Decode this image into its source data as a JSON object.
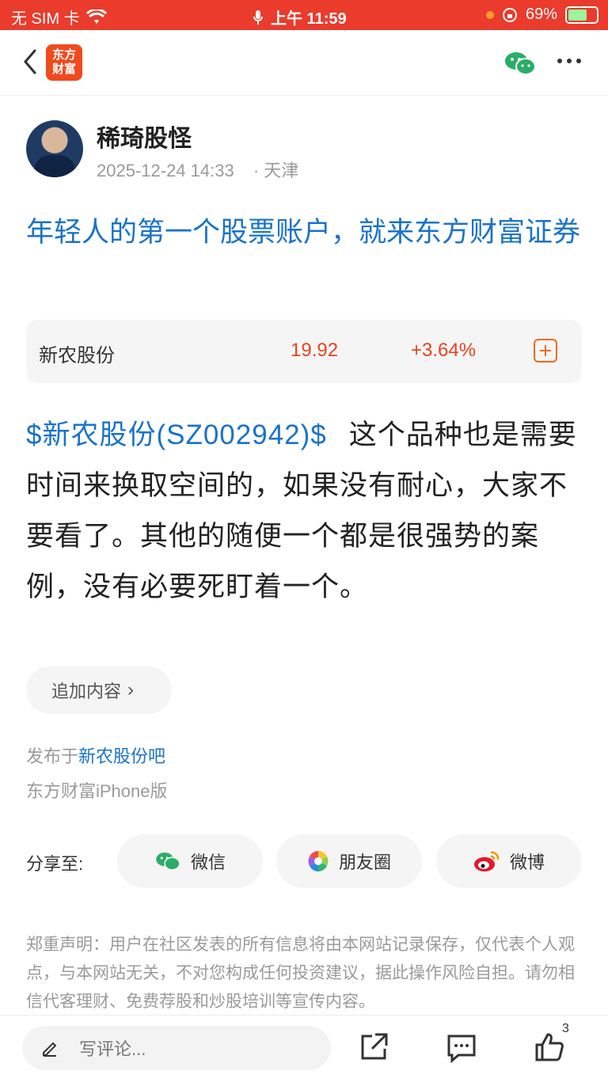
{
  "status_bar": {
    "carrier": "无 SIM 卡",
    "time": "上午 11:59",
    "battery": "69%"
  },
  "nav": {
    "logo_text": "东方财富",
    "wechat_icon": "wechat-icon",
    "more_icon": "more-icon"
  },
  "post": {
    "author_name": "稀琦股怪",
    "datetime": "2025-12-24 14:33",
    "location": "· 天津",
    "title": "年轻人的第一个股票账户，就来东方财富证券",
    "stock": {
      "name": "新农股份",
      "price": "19.92",
      "change": "+3.64%"
    },
    "body_tag": "$新农股份(SZ002942)$",
    "body_text": "这个品种也是需要时间来换取空间的，如果没有耐心，大家不要看了。其他的随便一个都是很强势的案例，没有必要死盯着一个。",
    "add_content": "追加内容",
    "published_prefix": "发布于",
    "published_bar": "新农股份吧",
    "device": "东方财富iPhone版"
  },
  "share": {
    "label": "分享至:",
    "wechat": "微信",
    "moments": "朋友圈",
    "weibo": "微博"
  },
  "disclaimer": "郑重声明：用户在社区发表的所有信息将由本网站记录保存，仅代表个人观点，与本网站无关，不对您构成任何投资建议，据此操作风险自担。请勿相信代客理财、免费荐股和炒股培训等宣传内容。",
  "bottom_bar": {
    "comment_placeholder": "写评论...",
    "like_count": "3"
  },
  "colors": {
    "status_bar": "#ea3b2c",
    "link_blue": "#1a73c9",
    "rise_red": "#e8431f",
    "brand_orange": "#f04a1d"
  }
}
